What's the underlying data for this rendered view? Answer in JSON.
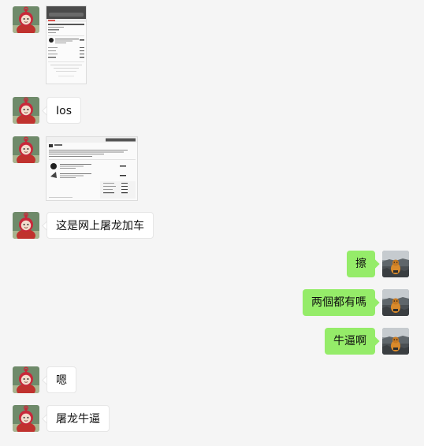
{
  "colors": {
    "background": "#f5f5f5",
    "bubble_left": "#ffffff",
    "bubble_right": "#95ec69"
  },
  "messages": [
    {
      "side": "left",
      "type": "image",
      "description": "phone-screenshot-receipt"
    },
    {
      "side": "left",
      "type": "text",
      "text": "Ios"
    },
    {
      "side": "left",
      "type": "image",
      "description": "web-screenshot-receipt"
    },
    {
      "side": "left",
      "type": "text",
      "text": "这是网上屠龙加车"
    },
    {
      "side": "right",
      "type": "text",
      "text": "擦"
    },
    {
      "side": "right",
      "type": "text",
      "text": "两個都有嗎"
    },
    {
      "side": "right",
      "type": "text",
      "text": "牛逼啊"
    },
    {
      "side": "left",
      "type": "text",
      "text": "嗯"
    },
    {
      "side": "left",
      "type": "text",
      "text": "屠龙牛逼"
    }
  ],
  "avatars": {
    "left": "teletubby-avatar",
    "right": "dog-on-rocks-avatar"
  }
}
